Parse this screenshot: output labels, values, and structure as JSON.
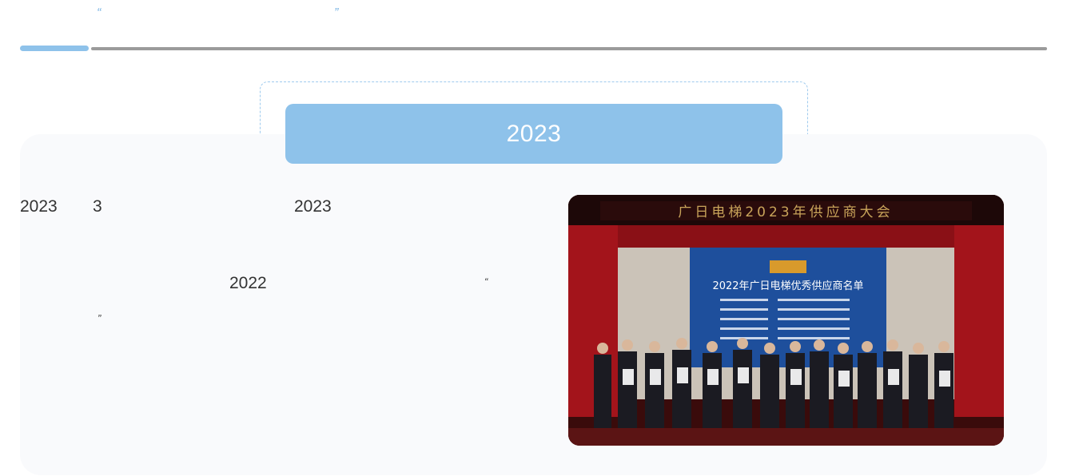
{
  "header": {
    "open_quote": "“",
    "close_quote": "”"
  },
  "timeline": {
    "active_year": "2023"
  },
  "content": {
    "line1": {
      "year": "2023",
      "month": "3",
      "year2": "2023"
    },
    "line2": {
      "year": "2022",
      "open_quote": "“"
    },
    "line3": {
      "close_quote": "”"
    }
  },
  "photo": {
    "banner_text": "广日电梯2023年供应商大会",
    "screen_title": "2022年广日电梯优秀供应商名单",
    "colors": {
      "curtain": "#a3141b",
      "screen": "#1e4f9c",
      "wall": "#cbc3b8",
      "stage": "#5b1414"
    }
  }
}
